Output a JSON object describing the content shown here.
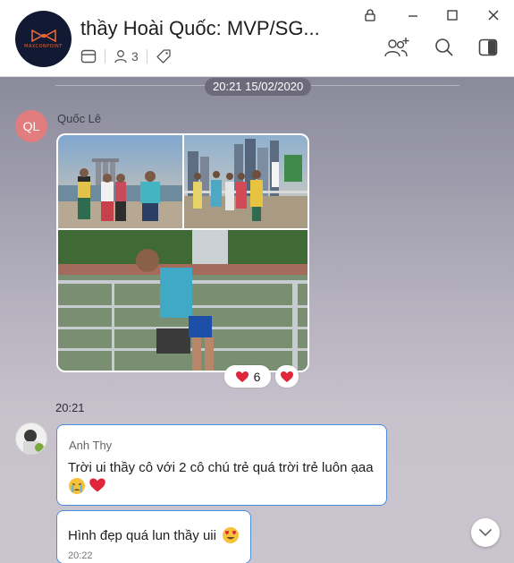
{
  "header": {
    "title": "thầy Hoài Quốc: MVP/SG...",
    "avatar_brand": "MAXCONPOINT",
    "member_count": "3"
  },
  "chat": {
    "date_separator": "20:21 15/02/2020",
    "messages": [
      {
        "avatar_initials": "QL",
        "sender": "Quốc Lê",
        "type": "photos",
        "reactions": [
          {
            "emoji": "heart",
            "count": "6"
          },
          {
            "emoji": "heart",
            "count": ""
          }
        ]
      },
      {
        "time": "20:21"
      },
      {
        "sender": "Anh Thy",
        "text": "Trời ui thầy cô với 2 cô chú trẻ quá trời trẻ luôn ạaa",
        "emojis": [
          "crying-face",
          "heart"
        ]
      },
      {
        "text": "Hình đẹp quá lun thầy uii",
        "emoji": "heart-eyes-face",
        "time": "20:22"
      }
    ]
  },
  "colors": {
    "avatar_ql": "#e27d7f",
    "bubble_border": "#4b8ee0",
    "date_pill": "#6d6a7c",
    "heart": "#e0263b"
  }
}
